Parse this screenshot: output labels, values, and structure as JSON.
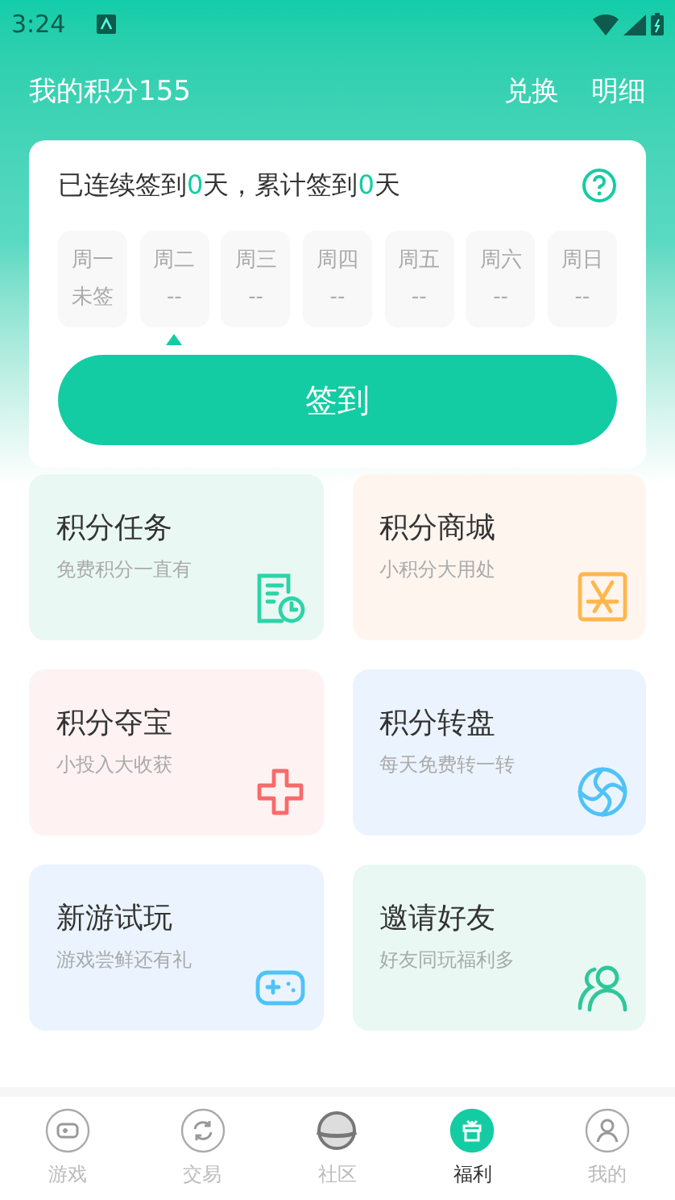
{
  "status_bar": {
    "time": "3:24"
  },
  "header": {
    "title": "我的积分155",
    "actions": [
      "兑换",
      "明细"
    ]
  },
  "checkin": {
    "summary": "已连续签到**0**天，累计签到**0**天",
    "days": [
      {
        "name": "周一",
        "status": "未签",
        "selected": false
      },
      {
        "name": "周二",
        "status": "--",
        "selected": true
      },
      {
        "name": "周三",
        "status": "--",
        "selected": false
      },
      {
        "name": "周四",
        "status": "--",
        "selected": false
      },
      {
        "name": "周五",
        "status": "--",
        "selected": false
      },
      {
        "name": "周六",
        "status": "--",
        "selected": false
      },
      {
        "name": "周日",
        "status": "--",
        "selected": false
      }
    ],
    "button": "签到"
  },
  "features": [
    {
      "kind": "task",
      "title": "积分任务",
      "subtitle": "免费积分一直有",
      "color": "#2ed3a8"
    },
    {
      "kind": "mall",
      "title": "积分商城",
      "subtitle": "小积分大用处",
      "color": "#ffb74d"
    },
    {
      "kind": "treasure",
      "title": "积分夺宝",
      "subtitle": "小投入大收获",
      "color": "#f76b6b"
    },
    {
      "kind": "wheel",
      "title": "积分转盘",
      "subtitle": "每天免费转一转",
      "color": "#4fc3f7"
    },
    {
      "kind": "game",
      "title": "新游试玩",
      "subtitle": "游戏尝鲜还有礼",
      "color": "#4fc3f7"
    },
    {
      "kind": "invite",
      "title": "邀请好友",
      "subtitle": "好友同玩福利多",
      "color": "#2ec79a"
    }
  ],
  "nav": [
    {
      "kind": "game",
      "label": "游戏",
      "selected": false
    },
    {
      "kind": "trade",
      "label": "交易",
      "selected": false
    },
    {
      "kind": "community",
      "label": "社区",
      "selected": false
    },
    {
      "kind": "welfare",
      "label": "福利",
      "selected": true
    },
    {
      "kind": "me",
      "label": "我的",
      "selected": false
    }
  ]
}
